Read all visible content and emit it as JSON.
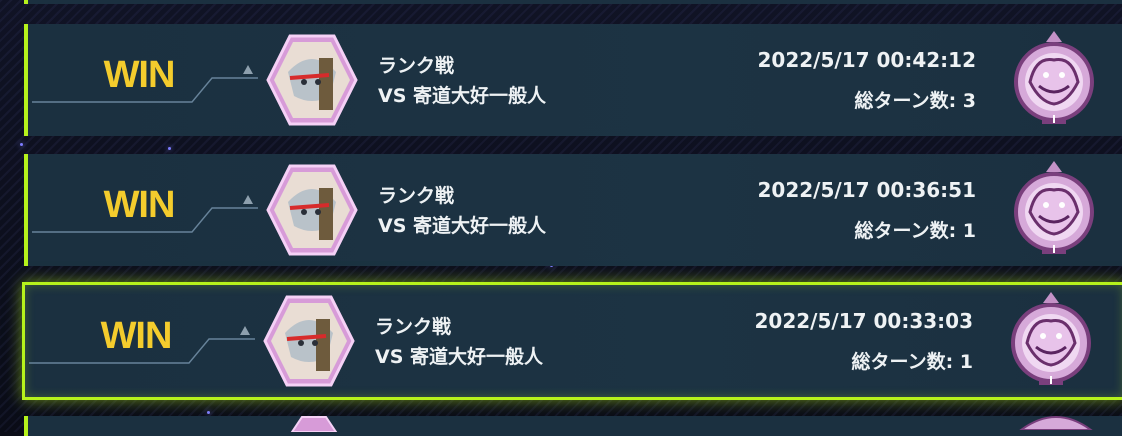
{
  "matches": [
    {
      "result": "WIN",
      "mode": "ランク戦",
      "opponent": "VS 寄道大好一般人",
      "datetime": "2022/5/17 00:42:12",
      "turns": "総ターン数: 3",
      "selected": false
    },
    {
      "result": "WIN",
      "mode": "ランク戦",
      "opponent": "VS 寄道大好一般人",
      "datetime": "2022/5/17 00:36:51",
      "turns": "総ターン数: 1",
      "selected": false
    },
    {
      "result": "WIN",
      "mode": "ランク戦",
      "opponent": "VS 寄道大好一般人",
      "datetime": "2022/5/17 00:33:03",
      "turns": "総ターン数: 1",
      "selected": true
    }
  ],
  "colors": {
    "win": "#f4cc2d",
    "accent": "#b6f21c",
    "card": "#1b3040",
    "emblem": "#d7a8d8"
  },
  "icons": {
    "avatar": "opponent-avatar-hexagon",
    "emblem": "rank-emblem-wolf"
  }
}
